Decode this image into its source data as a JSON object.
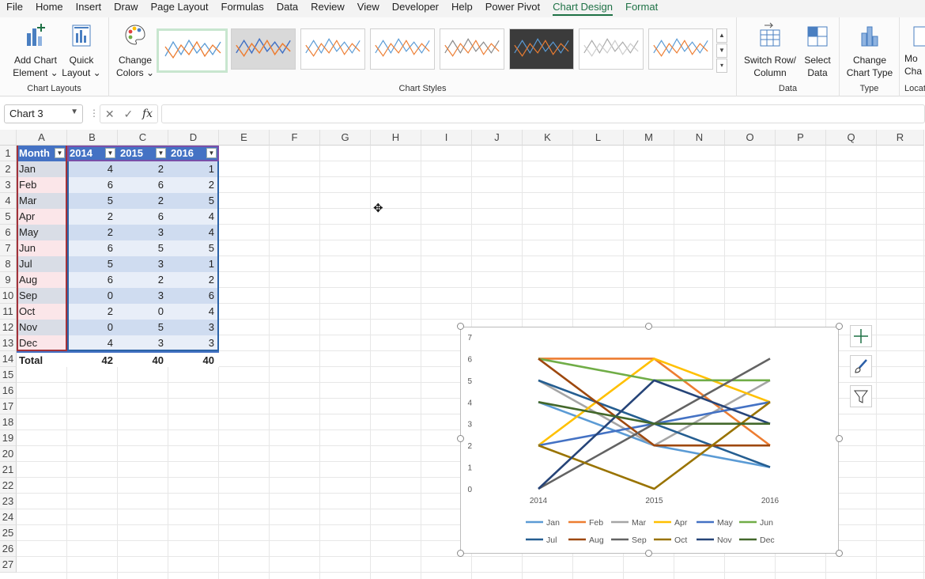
{
  "ribbon_tabs": [
    "File",
    "Home",
    "Insert",
    "Draw",
    "Page Layout",
    "Formulas",
    "Data",
    "Review",
    "View",
    "Developer",
    "Help",
    "Power Pivot",
    "Chart Design",
    "Format"
  ],
  "active_tab": "Chart Design",
  "ribbon": {
    "add_chart_element": [
      "Add Chart",
      "Element ⌄"
    ],
    "quick_layout": [
      "Quick",
      "Layout ⌄"
    ],
    "change_colors": [
      "Change",
      "Colors ⌄"
    ],
    "chart_layouts_label": "Chart Layouts",
    "chart_styles_label": "Chart Styles",
    "switch_row_col": [
      "Switch Row/",
      "Column"
    ],
    "select_data": [
      "Select",
      "Data"
    ],
    "data_label": "Data",
    "change_chart_type": [
      "Change",
      "Chart Type"
    ],
    "type_label": "Type",
    "move_chart": [
      "Mo",
      "Cha"
    ],
    "location_label": "Locat"
  },
  "formula_bar": {
    "name_box": "Chart 3",
    "fx": "fx",
    "formula": ""
  },
  "columns": [
    "A",
    "B",
    "C",
    "D",
    "E",
    "F",
    "G",
    "H",
    "I",
    "J",
    "K",
    "L",
    "M",
    "N",
    "O",
    "P",
    "Q",
    "R"
  ],
  "rows": [
    "1",
    "2",
    "3",
    "4",
    "5",
    "6",
    "7",
    "8",
    "9",
    "10",
    "11",
    "12",
    "13",
    "14",
    "15",
    "16",
    "17",
    "18",
    "19",
    "20",
    "21",
    "22",
    "23",
    "24",
    "25",
    "26",
    "27"
  ],
  "table": {
    "headers": [
      "Month",
      "2014",
      "2015",
      "2016"
    ],
    "rows": [
      [
        "Jan",
        "4",
        "2",
        "1"
      ],
      [
        "Feb",
        "6",
        "6",
        "2"
      ],
      [
        "Mar",
        "5",
        "2",
        "5"
      ],
      [
        "Apr",
        "2",
        "6",
        "4"
      ],
      [
        "May",
        "2",
        "3",
        "4"
      ],
      [
        "Jun",
        "6",
        "5",
        "5"
      ],
      [
        "Jul",
        "5",
        "3",
        "1"
      ],
      [
        "Aug",
        "6",
        "2",
        "2"
      ],
      [
        "Sep",
        "0",
        "3",
        "6"
      ],
      [
        "Oct",
        "2",
        "0",
        "4"
      ],
      [
        "Nov",
        "0",
        "5",
        "3"
      ],
      [
        "Dec",
        "4",
        "3",
        "3"
      ]
    ],
    "total": [
      "Total",
      "42",
      "40",
      "40"
    ]
  },
  "colors": {
    "accent": "#1e7145",
    "table_header": "#4472c4"
  },
  "chart_data": {
    "type": "line",
    "x": [
      "2014",
      "2015",
      "2016"
    ],
    "ylim": [
      0,
      7
    ],
    "yticks": [
      "0",
      "1",
      "2",
      "3",
      "4",
      "5",
      "6",
      "7"
    ],
    "grid": false,
    "legend": "bottom",
    "series": [
      {
        "name": "Jan",
        "values": [
          4,
          2,
          1
        ],
        "color": "#5b9bd5"
      },
      {
        "name": "Feb",
        "values": [
          6,
          6,
          2
        ],
        "color": "#ed7d31"
      },
      {
        "name": "Mar",
        "values": [
          5,
          2,
          5
        ],
        "color": "#a5a5a5"
      },
      {
        "name": "Apr",
        "values": [
          2,
          6,
          4
        ],
        "color": "#ffc000"
      },
      {
        "name": "May",
        "values": [
          2,
          3,
          4
        ],
        "color": "#4472c4"
      },
      {
        "name": "Jun",
        "values": [
          6,
          5,
          5
        ],
        "color": "#70ad47"
      },
      {
        "name": "Jul",
        "values": [
          5,
          3,
          1
        ],
        "color": "#255e91"
      },
      {
        "name": "Aug",
        "values": [
          6,
          2,
          2
        ],
        "color": "#9e480e"
      },
      {
        "name": "Sep",
        "values": [
          0,
          3,
          6
        ],
        "color": "#636363"
      },
      {
        "name": "Oct",
        "values": [
          2,
          0,
          4
        ],
        "color": "#997300"
      },
      {
        "name": "Nov",
        "values": [
          0,
          5,
          3
        ],
        "color": "#264478"
      },
      {
        "name": "Dec",
        "values": [
          4,
          3,
          3
        ],
        "color": "#43682b"
      }
    ]
  }
}
